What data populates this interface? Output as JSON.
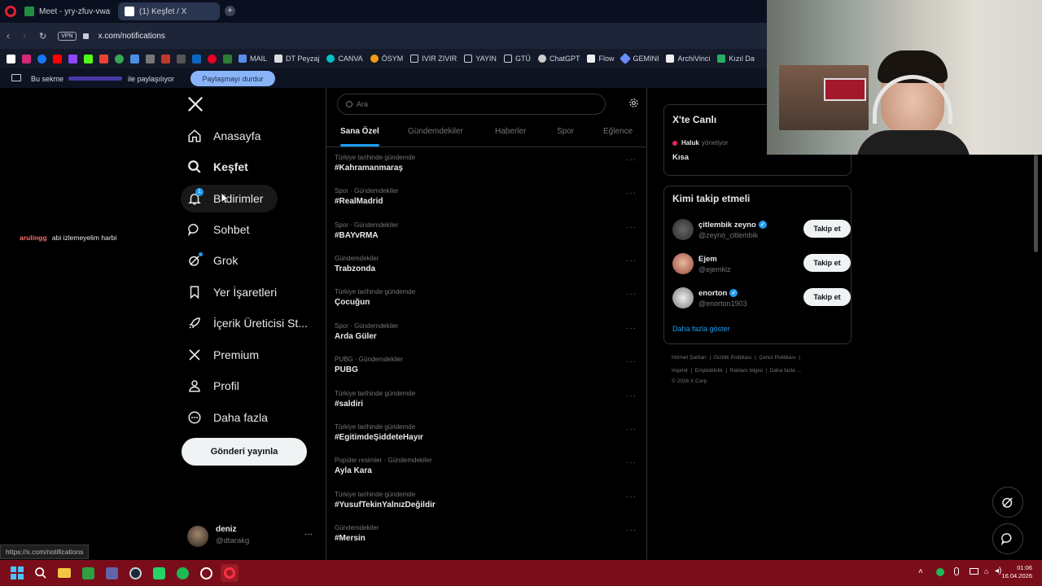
{
  "browser": {
    "tabs": [
      {
        "label": "Meet - yry-zfuv-vwa"
      },
      {
        "label": "(1) Keşfet / X"
      }
    ],
    "url": "x.com/notifications",
    "vpn_label": "VPN",
    "bookmarks": [
      "MAIL",
      "DT Peyzaj",
      "CANVA",
      "ÖSYM",
      "IVIR ZIVIR",
      "YAYIN",
      "GTÜ",
      "ChatGPT",
      "Flow",
      "GEMINI",
      "ArchiVinci",
      "Kızıl Da"
    ],
    "share_bar": {
      "prefix": "Bu sekme",
      "suffix": "ile paylaşılıyor",
      "stop_label": "Paylaşmayı durdur"
    },
    "status_url": "https://x.com/notifications"
  },
  "overlay_chat": {
    "user": "arulingg",
    "message": "abi izlemeyelim harbi"
  },
  "nav": {
    "items": [
      {
        "label": "Anasayfa"
      },
      {
        "label": "Keşfet"
      },
      {
        "label": "Bildirimler",
        "badge": "1"
      },
      {
        "label": "Sohbet"
      },
      {
        "label": "Grok"
      },
      {
        "label": "Yer İşaretleri"
      },
      {
        "label": "İçerik Üreticisi St..."
      },
      {
        "label": "Premium"
      },
      {
        "label": "Profil"
      },
      {
        "label": "Daha fazla"
      }
    ],
    "post_button": "Gönderi yayınla",
    "account": {
      "name": "deniz",
      "handle": "@dtarakg",
      "more": "···"
    }
  },
  "explore": {
    "search_placeholder": "Ara",
    "tabs": [
      "Sana Özel",
      "Gündemdekiler",
      "Haberler",
      "Spor",
      "Eğlence"
    ],
    "active_tab": "Sana Özel",
    "trends": [
      {
        "meta": "Türkiye tarihinde gündemde",
        "name": "#Kahramanmaraş"
      },
      {
        "meta": "Spor · Gündemdekiler",
        "name": "#RealMadrid"
      },
      {
        "meta": "Spor · Gündemdekiler",
        "name": "#BAYvRMA"
      },
      {
        "meta": "Gündemdekiler",
        "name": "Trabzonda"
      },
      {
        "meta": "Türkiye tarihinde gündemde",
        "name": "Çocuğun"
      },
      {
        "meta": "Spor · Gündemdekiler",
        "name": "Arda Güler"
      },
      {
        "meta": "PUBG · Gündemdekiler",
        "name": "PUBG"
      },
      {
        "meta": "Türkiye tarihinde gündemde",
        "name": "#saldiri"
      },
      {
        "meta": "Türkiye tarihinde gündemde",
        "name": "#EgitimdeŞiddeteHayır"
      },
      {
        "meta": "Popüler resimler · Gündemdekiler",
        "name": "Ayla Kara"
      },
      {
        "meta": "Türkiye tarihinde gündemde",
        "name": "#YusufTekinYalnızDeğildir"
      },
      {
        "meta": "Gündemdekiler",
        "name": "#Mersin"
      }
    ]
  },
  "sidebar": {
    "live": {
      "title": "X'te Canlı",
      "host": "Haluk",
      "host_suffix": "yönetiyor",
      "topic": "Kısa"
    },
    "who_to_follow": {
      "title": "Kimi takip etmeli",
      "users": [
        {
          "name": "çitlembik zeyno",
          "handle": "@zeyno_citlembik",
          "verified": true,
          "button": "Takip et"
        },
        {
          "name": "Ejem",
          "handle": "@ejemkiz",
          "verified": false,
          "button": "Takip et"
        },
        {
          "name": "enorton",
          "handle": "@enorton1903",
          "verified": true,
          "button": "Takip et"
        }
      ],
      "show_more": "Daha fazla göster"
    },
    "footer": {
      "line1": [
        "Hizmet Şartları",
        "Gizlilik Politikası",
        "Çerez Politikası"
      ],
      "line2": [
        "Imprint",
        "Erişilebilirlik",
        "Reklam bilgisi",
        "Daha fazla ..."
      ],
      "copyright": "© 2026 X Corp."
    }
  },
  "taskbar": {
    "time": "01:06",
    "date": "16.04.2026"
  },
  "colors": {
    "accent": "#1d9bf0",
    "taskbar": "#7a0d1a",
    "share_button": "#8ab4f8"
  }
}
